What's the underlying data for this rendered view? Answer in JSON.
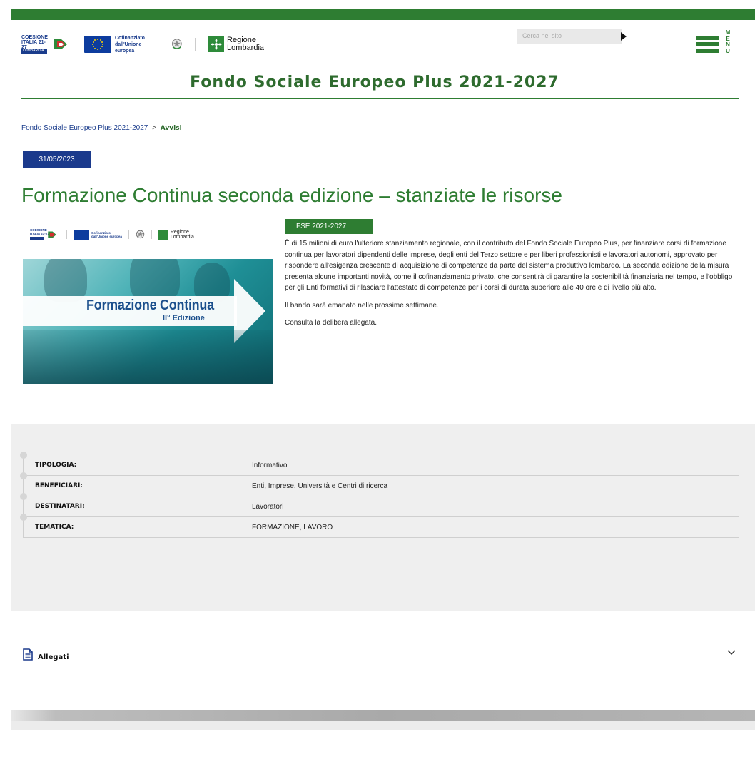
{
  "header": {
    "logos": {
      "coesione": [
        "COESIONE",
        "ITALIA 21-27"
      ],
      "coesione_band": "LOMBARDIA",
      "eu_line1": "Cofinanziato",
      "eu_line2": "dall'Unione europea",
      "regione_line1": "Regione",
      "regione_line2": "Lombardia"
    },
    "search_placeholder": "Cerca nel sito",
    "menu_letters": [
      "M",
      "E",
      "N",
      "U"
    ],
    "site_title": "Fondo Sociale Europeo Plus 2021-2027"
  },
  "breadcrumb": {
    "home": "Fondo Sociale Europeo Plus 2021-2027",
    "separator": ">",
    "current": "Avvisi"
  },
  "article": {
    "date": "31/05/2023",
    "title": "Formazione Continua seconda edizione – stanziate le risorse",
    "tag": "FSE 2021-2027",
    "featured_image": {
      "title": "Formazione Continua",
      "subtitle": "II° Edizione",
      "mini_eu_line1": "Cofinanziato",
      "mini_eu_line2": "dall'Unione europea",
      "mini_rl_line1": "Regione",
      "mini_rl_line2": "Lombardia",
      "mini_coesione": [
        "COESIONE",
        "ITALIA 21-27"
      ]
    },
    "paragraphs": [
      "È di 15 milioni di euro l'ulteriore stanziamento regionale, con il contributo del Fondo Sociale Europeo Plus, per finanziare corsi di formazione continua per lavoratori dipendenti delle imprese, degli enti del Terzo settore e per liberi professionisti e lavoratori autonomi, approvato per rispondere all'esigenza crescente di acquisizione di competenze da parte del sistema produttivo lombardo. La seconda edizione della misura presenta alcune importanti novità, come il cofinanziamento privato, che consentirà di garantire la sostenibilità finanziaria nel tempo, e l'obbligo per gli Enti formativi di rilasciare l'attestato di competenze per i corsi di durata superiore alle 40 ore e di livello più alto.",
      "Il bando sarà emanato nelle prossime settimane.",
      "Consulta la delibera allegata."
    ]
  },
  "info": {
    "rows": [
      {
        "key": "TIPOLOGIA",
        "value": "Informativo"
      },
      {
        "key": "BENEFICIARI",
        "value": "Enti, Imprese, Università e Centri di ricerca"
      },
      {
        "key": "DESTINATARI",
        "value": "Lavoratori"
      },
      {
        "key": "TEMATICA",
        "value": "FORMAZIONE, LAVORO"
      }
    ],
    "colon": ":"
  },
  "attachments": {
    "label": "Allegati"
  },
  "colors": {
    "brand_green": "#2e7d32",
    "date_blue": "#1b3a8c"
  }
}
